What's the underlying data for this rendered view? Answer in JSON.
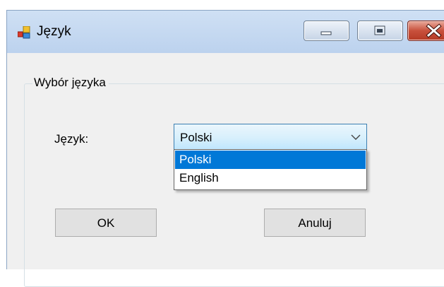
{
  "window": {
    "title": "Język",
    "icon": "application-icon",
    "controls": {
      "minimize": "minimize-icon",
      "maximize": "maximize-icon",
      "close": "close-icon"
    }
  },
  "group": {
    "title": "Wybór języka"
  },
  "language": {
    "label": "Język:",
    "selected": "Polski",
    "options": [
      "Polski",
      "English"
    ],
    "highlighted_index": 0
  },
  "buttons": {
    "ok_label": "OK",
    "cancel_label": "Anuluj"
  },
  "colors": {
    "selection": "#0078d7",
    "close_button": "#c8503c"
  }
}
